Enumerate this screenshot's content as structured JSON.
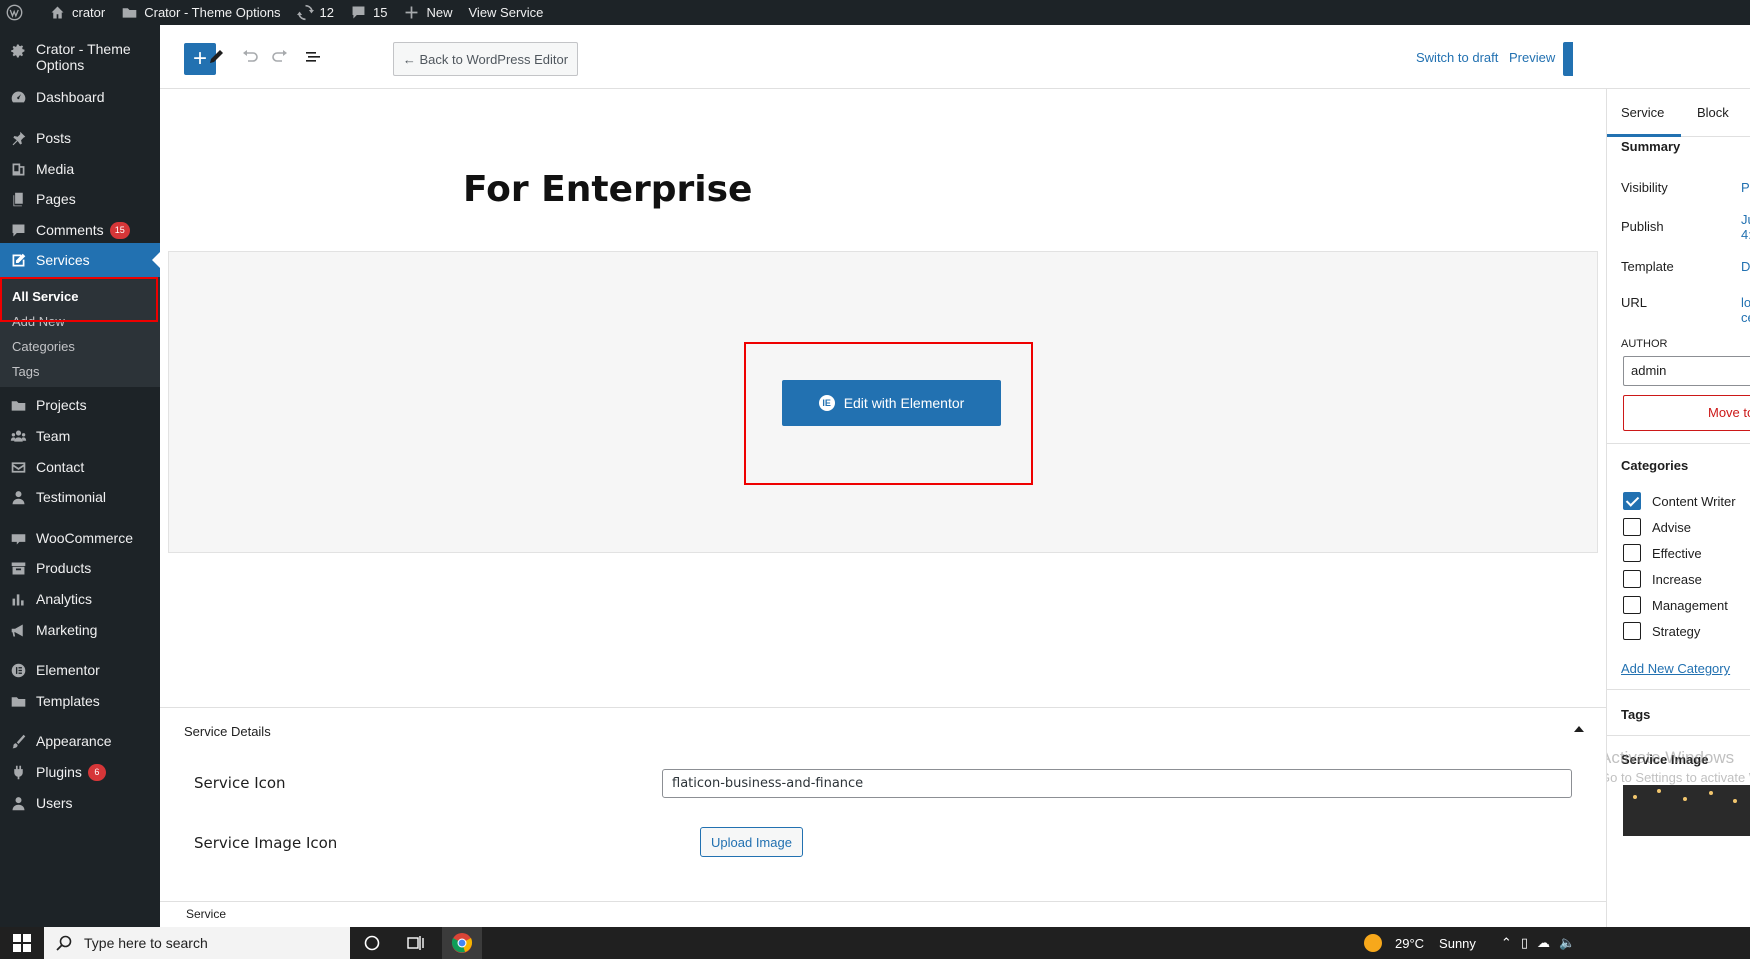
{
  "admin_bar": {
    "site": "crator",
    "theme_options": "Crator - Theme Options",
    "updates": "12",
    "comments": "15",
    "new": "New",
    "view": "View Service"
  },
  "sidebar": {
    "items": [
      {
        "label": "Crator - Theme",
        "label2": "Options",
        "icon": "gear-icon"
      },
      {
        "label": "Dashboard",
        "icon": "dashboard-icon"
      },
      {
        "label": "Posts",
        "icon": "pin-icon"
      },
      {
        "label": "Media",
        "icon": "media-icon"
      },
      {
        "label": "Pages",
        "icon": "pages-icon"
      },
      {
        "label": "Comments",
        "badge": "15",
        "icon": "comment-icon"
      },
      {
        "label": "Services",
        "icon": "edit-icon"
      },
      {
        "label": "Projects",
        "icon": "folder-icon"
      },
      {
        "label": "Team",
        "icon": "team-icon"
      },
      {
        "label": "Contact",
        "icon": "mail-icon"
      },
      {
        "label": "Testimonial",
        "icon": "user-icon"
      },
      {
        "label": "WooCommerce",
        "icon": "woo-icon"
      },
      {
        "label": "Products",
        "icon": "archive-icon"
      },
      {
        "label": "Analytics",
        "icon": "chart-icon"
      },
      {
        "label": "Marketing",
        "icon": "megaphone-icon"
      },
      {
        "label": "Elementor",
        "icon": "elementor-icon"
      },
      {
        "label": "Templates",
        "icon": "folder-icon"
      },
      {
        "label": "Appearance",
        "icon": "brush-icon"
      },
      {
        "label": "Plugins",
        "badge": "6",
        "icon": "plugin-icon"
      },
      {
        "label": "Users",
        "icon": "user-icon"
      }
    ],
    "submenu": [
      "All Service",
      "Add New",
      "Categories",
      "Tags"
    ]
  },
  "editor": {
    "back_button": "← Back to WordPress Editor",
    "switch_to_draft": "Switch to draft",
    "preview": "Preview",
    "title": "For Enterprise",
    "elementor_button": "Edit with Elementor",
    "elementor_logo": "IE"
  },
  "metabox": {
    "title": "Service Details",
    "icon_label": "Service Icon",
    "icon_value": "flaticon-business-and-finance",
    "image_label": "Service Image Icon",
    "upload_button": "Upload Image"
  },
  "footer": {
    "breadcrumb": "Service"
  },
  "settings_sidebar": {
    "tabs": [
      "Service",
      "Block"
    ],
    "summary_title": "Summary",
    "visibility_label": "Visibility",
    "visibility_value": "Pu",
    "publish_label": "Publish",
    "publish_value_1": "Ju",
    "publish_value_2": "4:",
    "template_label": "Template",
    "template_value": "D",
    "url_label": "URL",
    "url_value_1": "lo",
    "url_value_2": "ce",
    "author_label": "AUTHOR",
    "author_value": "admin",
    "trash_label": "Move to",
    "categories_title": "Categories",
    "categories": [
      {
        "label": "Content Writer",
        "checked": true
      },
      {
        "label": "Advise",
        "checked": false
      },
      {
        "label": "Effective",
        "checked": false
      },
      {
        "label": "Increase",
        "checked": false
      },
      {
        "label": "Management",
        "checked": false
      },
      {
        "label": "Strategy",
        "checked": false
      }
    ],
    "add_category": "Add New Category",
    "tags_title": "Tags",
    "service_image_title": "Service Image"
  },
  "watermark": {
    "line1": "Activate Windows",
    "line2": "Go to Settings to activate Windows."
  },
  "taskbar": {
    "search_placeholder": "Type here to search",
    "weather_temp": "29°C",
    "weather_desc": "Sunny"
  },
  "colors": {
    "accent": "#2271b1",
    "admin_dark": "#1d2327",
    "danger": "#d63638",
    "highlight_box": "#e00000"
  }
}
